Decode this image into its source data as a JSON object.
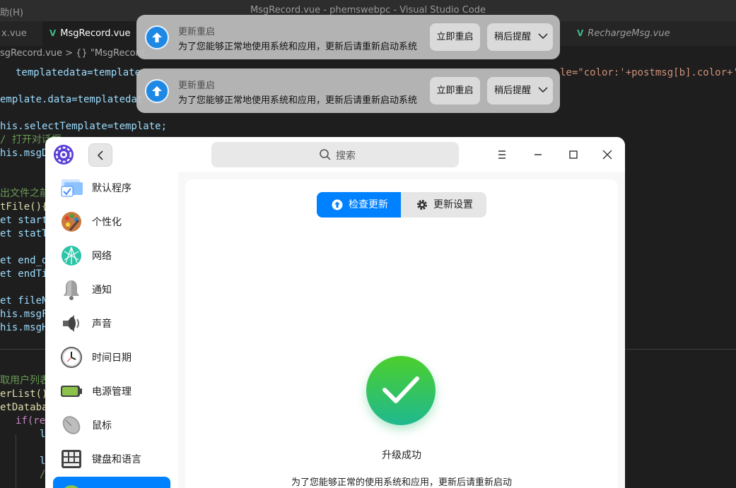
{
  "editor": {
    "menu_partial": "助(H)",
    "window_title": "MsgRecord.vue - phemswebpc - Visual Studio Code",
    "tabs": [
      {
        "label": "x.vue"
      },
      {
        "label": "MsgRecord.vue",
        "icon": "vue-icon"
      },
      {
        "label": "RechargeMsg.vue",
        "icon": "vue-icon"
      }
    ],
    "breadcrumb": "sgRecord.vue > {} \"MsgRecord.",
    "code_lines": [
      "templatedata=template",
      "le=\"color:'+postmsg[b].color+'",
      "emplate.data=templatedat",
      "his.selectTemplate=template;",
      "/ 打开对话框",
      "his.msgD",
      "出文件之前",
      "tFile(){",
      "et start",
      "et statT",
      "et end_d",
      "et endTi",
      "et fileN",
      "his.msgF",
      "his.msgH",
      "取用户列表",
      "erList()",
      "etDataba",
      "if(re",
      "l",
      "l",
      "/"
    ]
  },
  "notifications": [
    {
      "title": "更新重启",
      "message": "为了您能够正常地使用系统和应用，更新后请重新启动系统",
      "restart_now": "立即重启",
      "remind_later": "稍后提醒"
    },
    {
      "title": "更新重启",
      "message": "为了您能够正常地使用系统和应用，更新后请重新启动系统",
      "restart_now": "立即重启",
      "remind_later": "稍后提醒"
    }
  ],
  "control_center": {
    "search_placeholder": "搜索",
    "sidebar": [
      {
        "label": "默认程序",
        "icon": "default-apps-icon"
      },
      {
        "label": "个性化",
        "icon": "personalization-icon"
      },
      {
        "label": "网络",
        "icon": "network-icon"
      },
      {
        "label": "通知",
        "icon": "bell-icon"
      },
      {
        "label": "声音",
        "icon": "speaker-icon"
      },
      {
        "label": "时间日期",
        "icon": "clock-icon"
      },
      {
        "label": "电源管理",
        "icon": "battery-icon"
      },
      {
        "label": "鼠标",
        "icon": "mouse-icon"
      },
      {
        "label": "键盘和语言",
        "icon": "keyboard-icon"
      }
    ],
    "tabs": {
      "check_update": "检查更新",
      "update_settings": "更新设置"
    },
    "status_title": "升级成功",
    "status_desc": "为了您能够正常的使用系统和应用，更新后请重新启动",
    "colors": {
      "accent": "#0081ff",
      "success_top": "#4ccf2c",
      "success_bottom": "#1fb990"
    }
  }
}
